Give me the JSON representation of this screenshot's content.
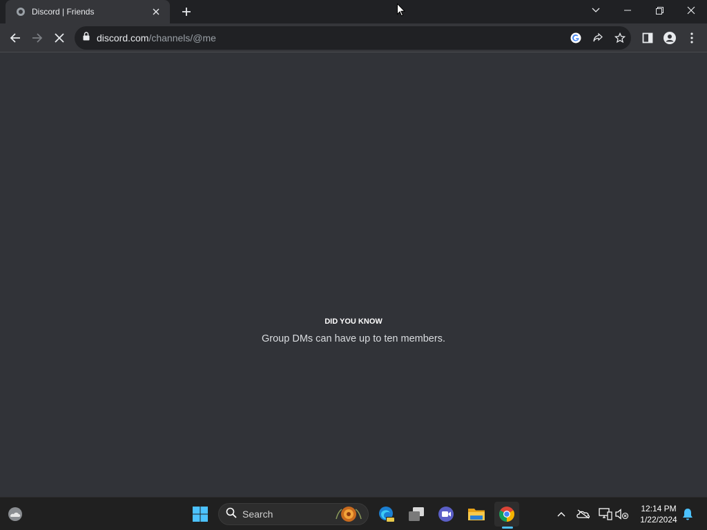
{
  "browser": {
    "tab": {
      "title": "Discord | Friends"
    },
    "omnibox": {
      "host": "discord.com",
      "path": "/channels/@me"
    }
  },
  "content": {
    "tip_heading": "DID YOU KNOW",
    "tip_text": "Group DMs can have up to ten members."
  },
  "taskbar": {
    "search_label": "Search",
    "clock": {
      "time": "12:14 PM",
      "date": "1/22/2024"
    }
  },
  "colors": {
    "page_background": "#313338",
    "tab_strip": "#202124",
    "toolbar": "#35363a",
    "taskbar": "#202020",
    "accent": "#4cc2ff"
  }
}
